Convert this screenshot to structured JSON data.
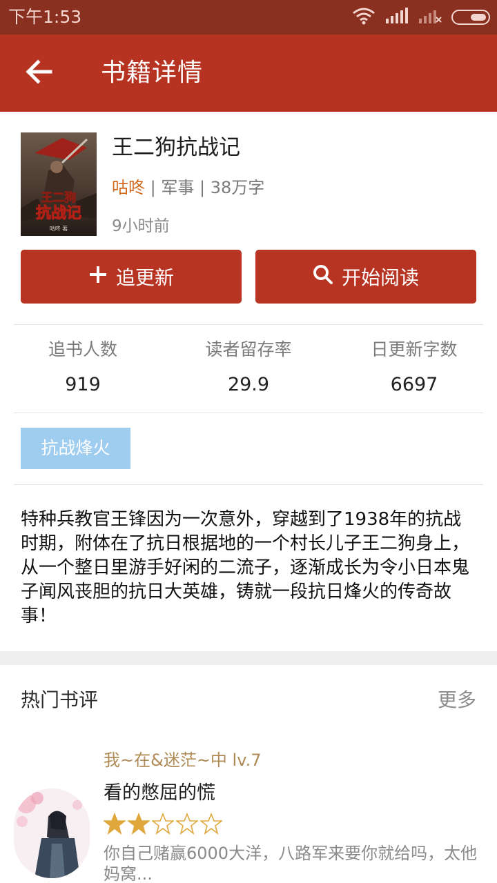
{
  "status_bar": {
    "time": "下午1:53",
    "icons": [
      "wifi-icon",
      "signal-icon",
      "signal-off-icon",
      "battery-icon"
    ]
  },
  "app_bar": {
    "title": "书籍详情",
    "back_icon": "arrow-left-icon"
  },
  "book": {
    "title": "王二狗抗战记",
    "author": "咕咚",
    "separator": " | ",
    "category": "军事",
    "word_count": "38万字",
    "updated": "9小时前",
    "cover_text": "王二狗抗战记",
    "cover_author": "咕咚 著"
  },
  "actions": {
    "follow_label": "追更新",
    "read_label": "开始阅读"
  },
  "stats": [
    {
      "label": "追书人数",
      "value": "919"
    },
    {
      "label": "读者留存率",
      "value": "29.9"
    },
    {
      "label": "日更新字数",
      "value": "6697"
    }
  ],
  "tags": [
    "抗战烽火"
  ],
  "description": "特种兵教官王锋因为一次意外，穿越到了1938年的抗战时期，附体在了抗日根据地的一个村长儿子王二狗身上，从一个整日里游手好闲的二流子，逐渐成长为令小日本鬼子闻风丧胆的抗日大英雄，铸就一段抗日烽火的传奇故事！",
  "reviews_section": {
    "title": "热门书评",
    "more_label": "更多"
  },
  "review": {
    "reviewer": "我~在&迷茫~中 lv.7",
    "title": "看的憋屈的慌",
    "rating": 2,
    "max_rating": 5,
    "excerpt": "你自己赌赢6000大洋，八路军来要你就给吗，太他妈窝..."
  },
  "colors": {
    "status_bar": "#8a3020",
    "app_bar": "#b73321",
    "button": "#b83422",
    "author": "#d2691e",
    "tag": "#9fcdf0",
    "reviewer": "#b08a55",
    "star": "#e0a83c"
  }
}
